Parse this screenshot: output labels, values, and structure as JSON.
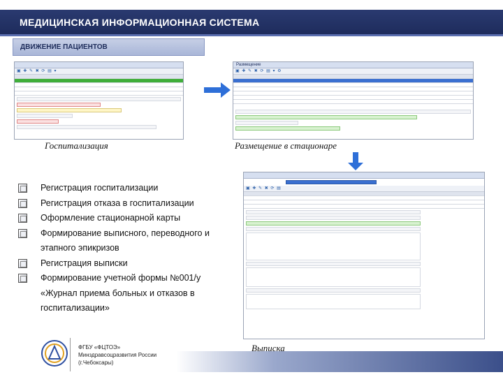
{
  "header": {
    "title": "МЕДИЦИНСКАЯ ИНФОРМАЦИОННАЯ СИСТЕМА"
  },
  "section": {
    "title": "ДВИЖЕНИЕ ПАЦИЕНТОВ"
  },
  "screens": {
    "hospitalization": {
      "caption": "Госпитализация"
    },
    "placement": {
      "caption": "Размещение в стационаре",
      "window_title": "Размещение"
    },
    "discharge": {
      "caption": "Выписка"
    }
  },
  "features": [
    "Регистрация госпитализации",
    "Регистрация отказа в госпитализации",
    "Оформление стационарной карты",
    "Формирование выписного, переводного и этапного эпикризов",
    "Регистрация выписки",
    "Формирование учетной формы №001/у «Журнал приема больных и отказов в госпитализации»"
  ],
  "organization": {
    "line1": "ФГБУ «ФЦТОЭ»",
    "line2": "Минздравсоцразвития России",
    "line3": "(г.Чебоксары)"
  },
  "colors": {
    "title_bg": "#1e2c5c",
    "accent": "#3a6fd0",
    "arrow": "#2e6fd8"
  }
}
